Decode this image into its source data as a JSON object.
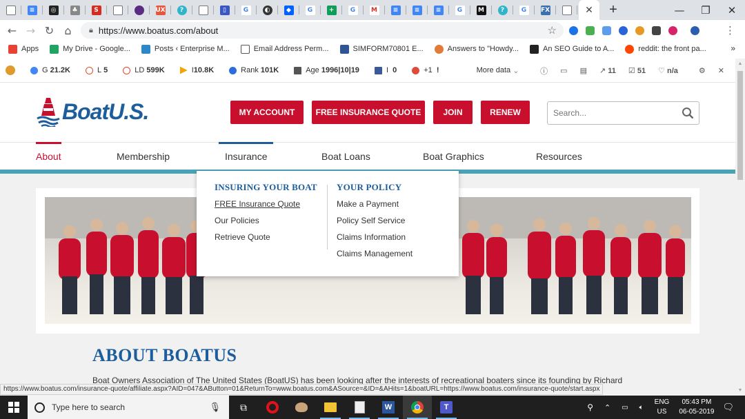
{
  "browser": {
    "tab_close": "✕",
    "new_tab": "+",
    "window_controls": {
      "minimize": "—",
      "restore": "❐",
      "close": "✕"
    },
    "url": "https://www.boatus.com/about",
    "bookmarks": [
      {
        "label": "Apps",
        "icon": "apps-grid-icon",
        "color": "#e94235"
      },
      {
        "label": "My Drive - Google...",
        "icon": "google-drive-icon",
        "color": "#1fa463"
      },
      {
        "label": "Posts ‹ Enterprise M...",
        "icon": "wordpress-icon",
        "color": "#2d88c9"
      },
      {
        "label": "Email Address Perm...",
        "icon": "document-icon",
        "color": "#555555"
      },
      {
        "label": "SIMFORM70801 E...",
        "icon": "power-automate-icon",
        "color": "#2f5597"
      },
      {
        "label": "Answers to \"Howdy...",
        "icon": "answers-icon",
        "color": "#e07b39"
      },
      {
        "label": "An SEO Guide to A...",
        "icon": "seo-icon",
        "color": "#222222"
      },
      {
        "label": "reddit: the front pa...",
        "icon": "reddit-icon",
        "color": "#ff4500"
      }
    ],
    "bookmarks_more": "»",
    "status_url": "https://www.boatus.com/insurance-quote/affiliate.aspx?AID=047&AButton=01&ReturnTo=www.boatus.com&ASource=&ID=&AHits=1&boatURL=https://www.boatus.com/insurance-quote/start.aspx"
  },
  "seo_bar": {
    "items": [
      {
        "label": "G",
        "value": "21.2K",
        "color": "#4285f4"
      },
      {
        "label": "L",
        "value": "5",
        "color": "#e04a2b"
      },
      {
        "label": "LD",
        "value": "599K",
        "color": "#e04a2b"
      },
      {
        "label": "I",
        "value": "10.8K",
        "color": "#f0a500"
      },
      {
        "label": "Rank",
        "value": "101K",
        "color": "#2d6cdf"
      },
      {
        "label": "Age",
        "value": "1996|10|19",
        "color": "#555555"
      },
      {
        "label": "I",
        "value": "0",
        "color": "#3b5998"
      },
      {
        "label": "+1",
        "value": "!",
        "color": "#dd4b39"
      }
    ],
    "more_data": "More data",
    "right_values": [
      "11",
      "51",
      "n/a"
    ]
  },
  "site": {
    "logo_text": "BoatU.S.",
    "buttons": [
      "MY ACCOUNT",
      "FREE INSURANCE QUOTE",
      "JOIN",
      "RENEW"
    ],
    "search_placeholder": "Search...",
    "nav": [
      "About",
      "Membership",
      "Insurance",
      "Boat Loans",
      "Boat Graphics",
      "Resources"
    ],
    "dropdown": {
      "col1_heading": "INSURING YOUR BOAT",
      "col1_links": [
        "FREE Insurance Quote",
        "Our Policies",
        "Retrieve Quote"
      ],
      "col2_heading": "YOUR POLICY",
      "col2_links": [
        "Make a Payment",
        "Policy Self Service",
        "Claims Information",
        "Claims Management"
      ]
    },
    "about_title": "ABOUT BOATUS",
    "about_text": "Boat Owners Association of The United States (BoatUS) has been looking after the interests of recreational boaters since its founding by Richard"
  },
  "taskbar": {
    "search_placeholder": "Type here to search",
    "lang_top": "ENG",
    "lang_bottom": "US",
    "time": "05:43 PM",
    "date": "06-05-2019"
  },
  "colors": {
    "brand_red": "#c8102e",
    "brand_blue": "#1d5d9b",
    "teal_bar": "#4aa3b3"
  }
}
